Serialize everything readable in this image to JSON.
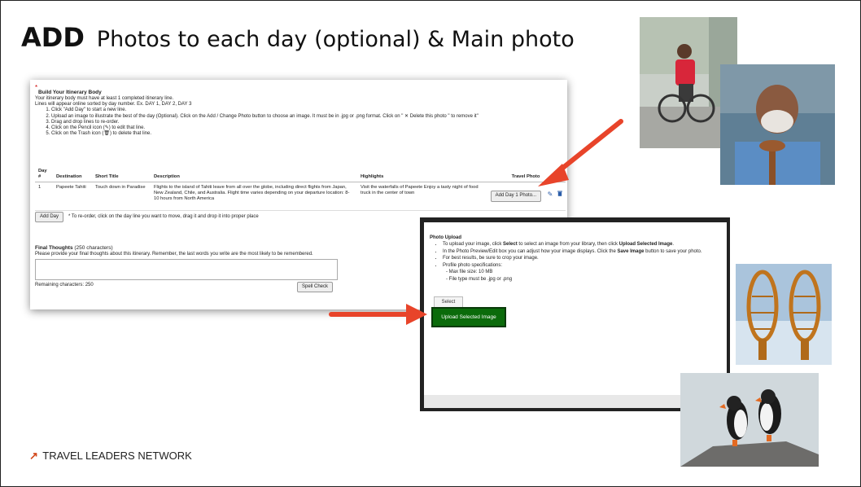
{
  "slide": {
    "title_bold": "ADD",
    "title_rest": "Photos to each day (optional) & Main photo",
    "logo_text": "TRAVEL LEADERS NETWORK",
    "logo_mark": "↗"
  },
  "itinerary": {
    "required_mark": "*",
    "heading": "Build Your Itinerary Body",
    "intro_lines": [
      "Your itinerary body must have at least 1 completed itinerary line.",
      "Lines will appear online sorted by day number. Ex. DAY 1, DAY 2, DAY 3"
    ],
    "steps": [
      "Click \"Add Day\" to start a new line.",
      "Upload an image to illustrate the best of the day (Optional). Click on the Add / Change Photo button to choose an image. It must be in .jpg or .png format. Click on \" ✕ Delete this photo \" to remove it\"",
      "Drag and drop lines to re-order.",
      "Click on the Pencil icon (✎) to edit that line.",
      "Click on the Trash icon (🗑) to delete that line."
    ],
    "columns": {
      "day": "Day #",
      "destination": "Destination",
      "short_title": "Short Title",
      "description": "Description",
      "highlights": "Highlights",
      "travel_photo": "Travel Photo"
    },
    "rows": [
      {
        "day": "1",
        "destination": "Papeete Tahiti",
        "short_title": "Touch down in Paradise",
        "description": "Flights to the island of Tahiti leave from all over the globe, including direct flights from Japan, New Zealand, Chile, and Australia. Flight time varies depending on your departure location: 8-10 hours from North America",
        "highlights": "Visit the waterfalls of Papeete Enjoy a tasty night of food truck in the center of town",
        "photo_button": "Add Day 1 Photo..."
      }
    ],
    "add_day_label": "Add Day",
    "reorder_note": "* To re-order, click on the day line you want to move, drag it and drop it into proper place",
    "final_thoughts_heading": "Final Thoughts",
    "final_thoughts_limit": "(250 characters)",
    "final_thoughts_desc": "Please provide your final thoughts about this itinerary. Remember, the last words you write are the most likely to be remembered.",
    "remaining_label": "Remaining characters: 250",
    "spell_check_label": "Spell Check"
  },
  "upload": {
    "heading": "Photo Upload",
    "bullets": [
      {
        "pre": "To upload your image, click ",
        "b1": "Select",
        "mid": " to select an image from your library, then click ",
        "b2": "Upload Selected Image",
        "post": "."
      },
      {
        "pre": "In the Photo Preview/Edit box you can adjust how your image displays. Click the ",
        "b1": "Save Image",
        "mid": " button to save your photo.",
        "b2": "",
        "post": ""
      },
      {
        "pre": "For best results, be sure to crop your image.",
        "b1": "",
        "mid": "",
        "b2": "",
        "post": ""
      },
      {
        "pre": "Profile photo specifications:",
        "b1": "",
        "mid": "",
        "b2": "",
        "post": ""
      }
    ],
    "specs": [
      "- Max file size: 10 MB",
      "- File type must be .jpg or .png"
    ],
    "select_label": "Select",
    "upload_label": "Upload Selected Image"
  },
  "colors": {
    "arrow": "#e8442a",
    "upload_green": "#0b6b0b",
    "icon_blue": "#2a5ca8",
    "brand_orange": "#d24a1d"
  }
}
